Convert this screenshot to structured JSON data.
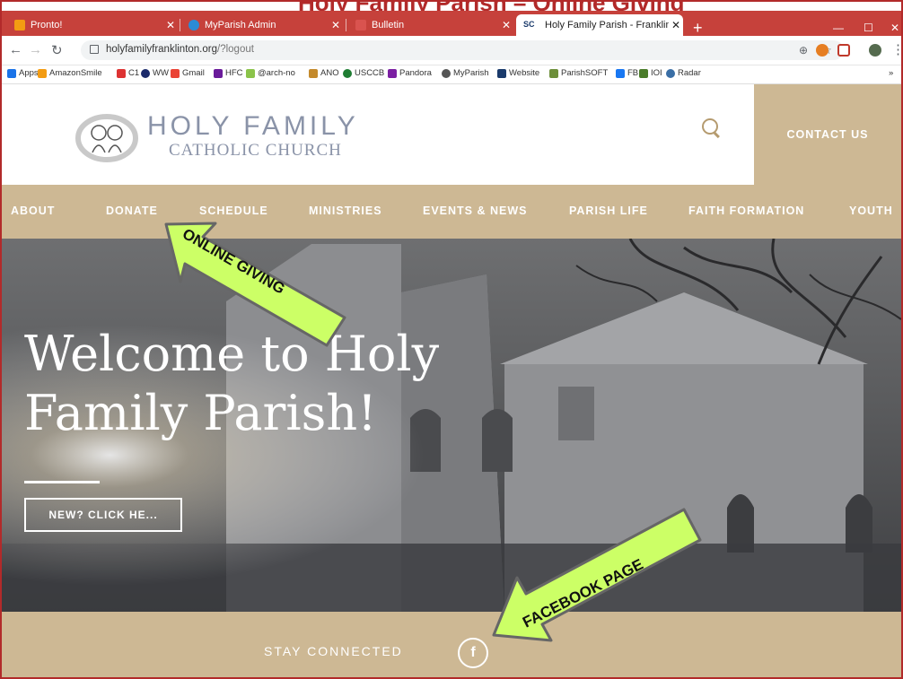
{
  "doc_title": "Holy Family Parish – Online Giving",
  "browser": {
    "tabs": [
      {
        "label": "Pronto!",
        "color": "#f39c12"
      },
      {
        "label": "MyParish Admin",
        "color": "#2b8bd6"
      },
      {
        "label": "Bulletin",
        "color": "#d9534f"
      },
      {
        "label": "Holy Family Parish - Franklinton",
        "color": "#1a3a6b",
        "badge": "SC"
      }
    ],
    "new_tab": "+",
    "url_host": "holyfamilyfranklinton.org",
    "url_path": "/?logout",
    "bookmarks": [
      "Apps",
      "AmazonSmile",
      "C1",
      "WW",
      "Gmail",
      "HFC",
      "@arch-no",
      "ANO",
      "USCCB",
      "Pandora",
      "MyParish",
      "Website",
      "ParishSOFT",
      "FB",
      "IOI",
      "Radar"
    ],
    "more": "»"
  },
  "site": {
    "logo_title": "HOLY FAMILY",
    "logo_subtitle": "CATHOLIC CHURCH",
    "contact": "CONTACT US",
    "nav": [
      "ABOUT",
      "DONATE",
      "SCHEDULE",
      "MINISTRIES",
      "EVENTS & NEWS",
      "PARISH LIFE",
      "FAITH FORMATION",
      "YOUTH"
    ],
    "hero_title": "Welcome to Holy Family Parish!",
    "hero_button": "NEW? CLICK HE...",
    "stay_connected": "STAY CONNECTED",
    "facebook_glyph": "f"
  },
  "annotations": {
    "online_giving": "ONLINE GIVING",
    "facebook_page": "FACEBOOK PAGE",
    "arrow_fill": "#ccff66",
    "arrow_stroke": "#666666"
  },
  "colors": {
    "tabbar": "#c6413b",
    "accent_tan": "#cdb894",
    "frame_red": "#b22a2a"
  }
}
